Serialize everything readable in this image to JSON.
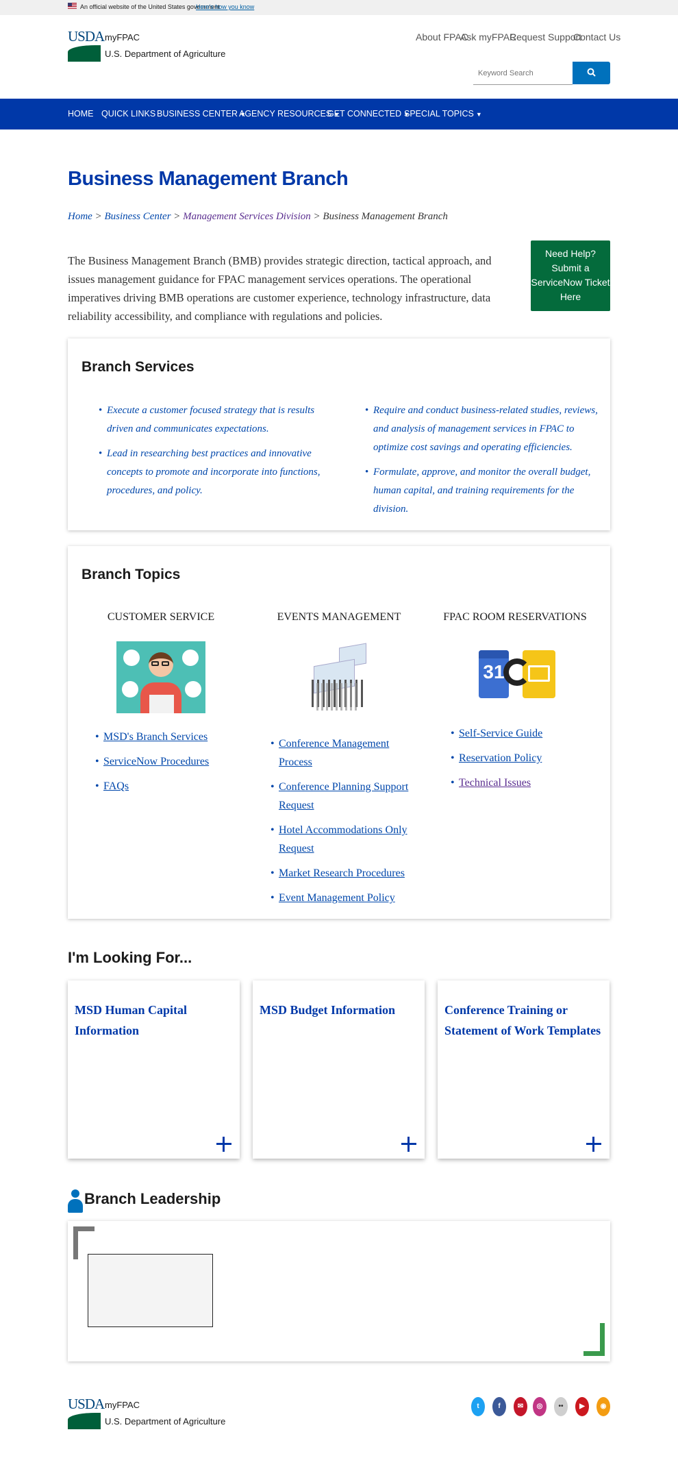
{
  "gov_banner": {
    "text": "An official website of the United States government",
    "link": "Here's how you know"
  },
  "header": {
    "logo_text": "USDA",
    "site_name_line1": "myFPAC",
    "site_name_line2": "U.S. Department of Agriculture",
    "utility_links": [
      "About FPAC",
      "Ask myFPAC",
      "Request Support",
      "Contact Us"
    ],
    "search_placeholder": "Keyword Search"
  },
  "nav": {
    "items": [
      {
        "label": "HOME",
        "dropdown": false
      },
      {
        "label": "QUICK LINKS",
        "dropdown": false
      },
      {
        "label": "BUSINESS CENTER",
        "dropdown": true
      },
      {
        "label": "AGENCY RESOURCES",
        "dropdown": true
      },
      {
        "label": "GET CONNECTED",
        "dropdown": true
      },
      {
        "label": "SPECIAL TOPICS",
        "dropdown": true
      }
    ]
  },
  "page": {
    "title": "Business Management Branch",
    "breadcrumb": {
      "home": "Home",
      "sep": " > ",
      "business_center": "Business Center",
      "msd": "Management Services Division",
      "current": "Business Management Branch"
    },
    "intro": "The Business Management Branch (BMB) provides strategic direction, tactical approach, and issues management guidance for FPAC management services operations. The operational imperatives driving BMB operations are customer experience, technology infrastructure, data reliability accessibility, and compliance with regulations and policies.",
    "help_button": "Need Help? Submit a ServiceNow Ticket Here"
  },
  "branch_services": {
    "title": "Branch Services",
    "left": [
      "Execute a customer focused strategy that is results driven and communicates expectations.",
      "Lead in researching best practices and innovative concepts to promote and incorporate into functions, procedures, and policy."
    ],
    "right": [
      "Require and conduct business-related studies, reviews, and analysis of management services in FPAC to optimize cost savings and operating efficiencies.",
      "Formulate, approve, and monitor the overall budget, human capital, and training requirements for the division."
    ]
  },
  "branch_topics": {
    "title": "Branch Topics",
    "columns": [
      {
        "title": "CUSTOMER SERVICE",
        "links": [
          "MSD's Branch Services",
          "ServiceNow Procedures",
          "FAQs"
        ]
      },
      {
        "title": "EVENTS MANAGEMENT",
        "links": [
          "Conference Management Process",
          "Conference Planning Support Request",
          "Hotel Accommodations Only Request",
          "Market Research Procedures",
          "Event Management Policy"
        ]
      },
      {
        "title": "FPAC ROOM RESERVATIONS",
        "links": [
          "Self-Service Guide",
          "Reservation Policy",
          "Technical Issues"
        ]
      }
    ],
    "calendar_number": "31"
  },
  "looking_for": {
    "title": "I'm Looking For...",
    "cards": [
      "MSD Human Capital Information",
      "MSD Budget Information",
      "Conference Training or Statement of Work Templates"
    ]
  },
  "leadership": {
    "title": "Branch Leadership"
  },
  "footer": {
    "logo_text": "USDA",
    "site_name_line1": "myFPAC",
    "site_name_line2": "U.S. Department of Agriculture",
    "social": [
      {
        "name": "twitter-icon",
        "color": "#1da1f2"
      },
      {
        "name": "facebook-icon",
        "color": "#3b5998"
      },
      {
        "name": "govdelivery-icon",
        "color": "#c4162a"
      },
      {
        "name": "instagram-icon",
        "color": "#c13584"
      },
      {
        "name": "flickr-icon",
        "color": "#cfcfcf"
      },
      {
        "name": "youtube-icon",
        "color": "#cc181e"
      },
      {
        "name": "rss-icon",
        "color": "#f39c12"
      }
    ]
  }
}
